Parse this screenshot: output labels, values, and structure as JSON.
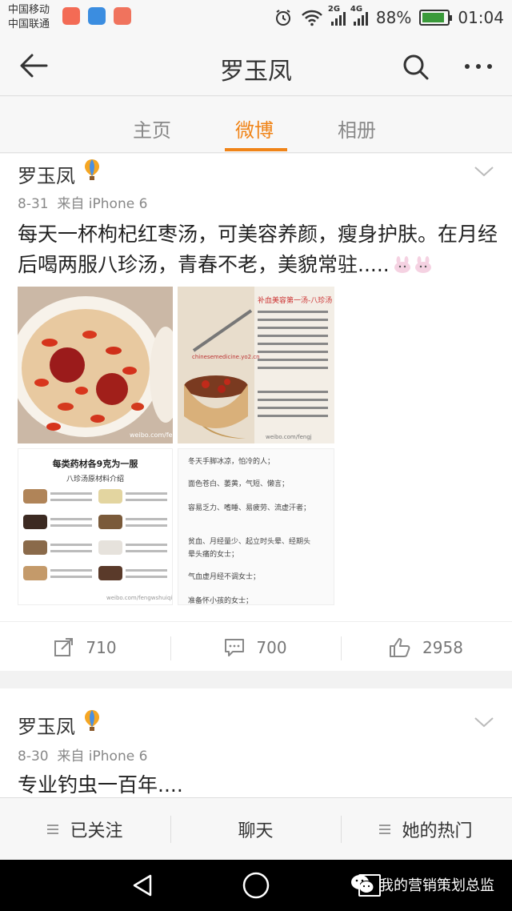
{
  "status_bar": {
    "carrier_1": "中国移动",
    "carrier_2": "中国联通",
    "network_1": "2G",
    "network_2": "4G",
    "battery": "88%",
    "battery_level": 0.88,
    "time": "01:04"
  },
  "nav": {
    "title": "罗玉凤"
  },
  "tabs": [
    {
      "label": "主页",
      "active": false
    },
    {
      "label": "微博",
      "active": true
    },
    {
      "label": "相册",
      "active": false
    }
  ],
  "posts": [
    {
      "author": "罗玉凤",
      "date": "8-31",
      "source": "来自 iPhone 6",
      "text": "每天一杯枸杞红枣汤，可美容养颜，瘦身护肤。在月经后喝两服八珍汤，青春不老，美貌常驻.....",
      "images": {
        "img1_watermark": "weibo.com/feng",
        "img2_title": "补血美容第一汤-八珍汤",
        "img2_url": "chinesemedicine.yo2.cn",
        "img2_watermark": "weibo.com/fengj",
        "img3_title": "每类药材各9克为一服",
        "img3_subtitle": "八珍汤原材料介绍",
        "img3_watermark": "weibo.com/fengwshuiqing",
        "img4_lines": [
          "冬天手脚冰凉，怕冷的人；",
          "面色苍白、萎黄，气短、懒言；",
          "容易乏力、嗜睡、易疲劳、流虚汗者；",
          "贫血、月经量少、起立时头晕、经期头",
          "晕头痛的女士；",
          "气血虚月经不调女士；",
          "准备怀小孩的女士；"
        ]
      },
      "reposts": "710",
      "comments": "700",
      "likes": "2958"
    },
    {
      "author": "罗玉凤",
      "date": "8-30",
      "source": "来自 iPhone 6",
      "text": "专业钓虫一百年...."
    }
  ],
  "bottom_bar": {
    "following": "已关注",
    "chat": "聊天",
    "hot": "她的热门"
  },
  "watermark": "我的营销策划总监",
  "colors": {
    "accent": "#f08418",
    "battery_green": "#3a9a3a"
  }
}
